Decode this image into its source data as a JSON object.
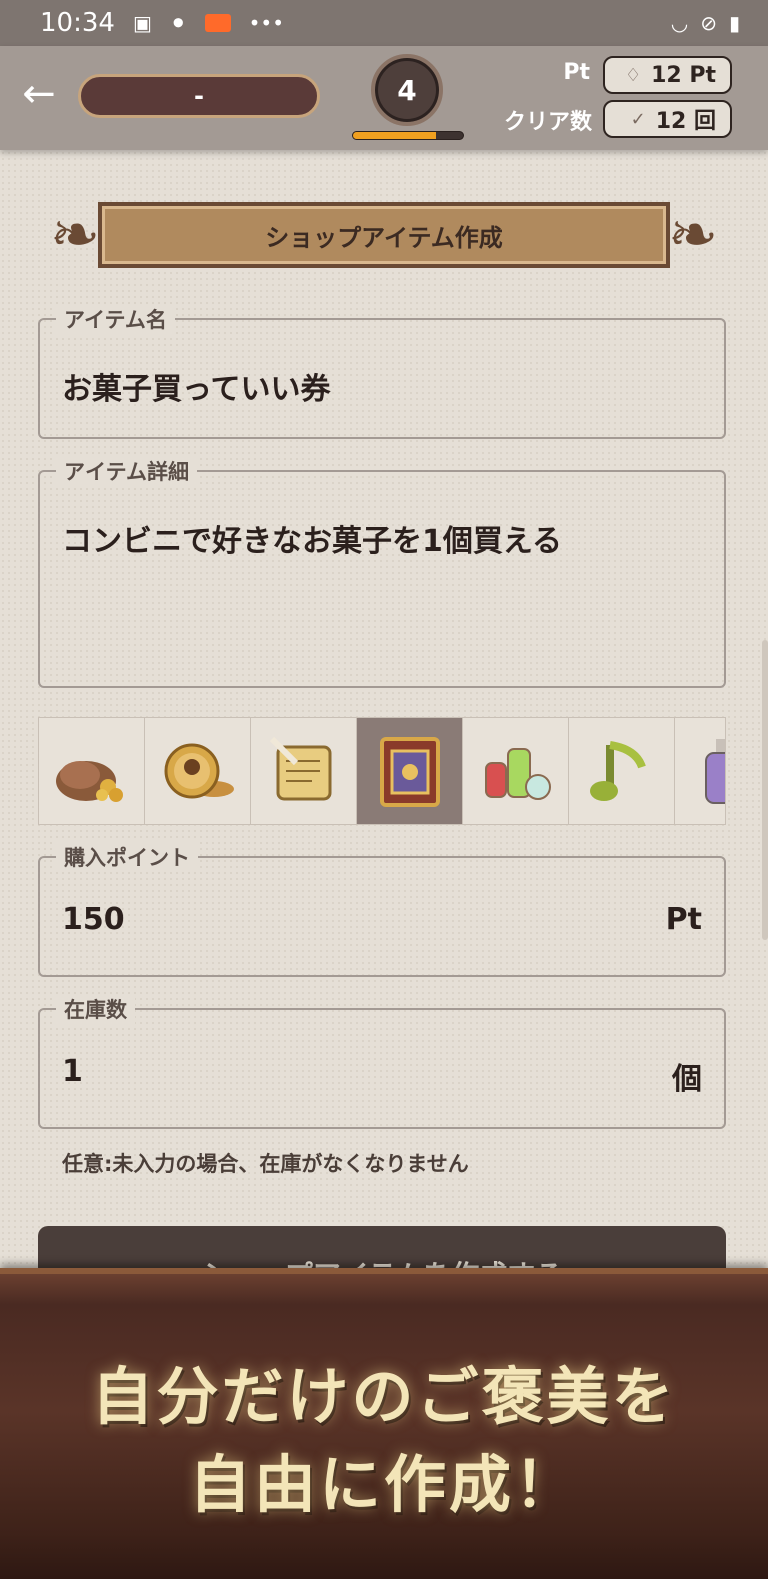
{
  "status_bar": {
    "time": "10:34",
    "icons": [
      "image-icon",
      "voicemail-icon",
      "record-icon",
      "more-icon"
    ],
    "more": "•••",
    "right_icons": [
      "wifi-icon",
      "dnd-icon",
      "battery-icon"
    ]
  },
  "header": {
    "back": "←",
    "name": "-",
    "level": "4",
    "level_progress": 0.75,
    "pt_label": "Pt",
    "pt_value": "12 Pt",
    "clear_label": "クリア数",
    "clear_value": "12 回",
    "pt_icon": "diamond-icon",
    "clear_icon": "check-icon"
  },
  "title": "ショップアイテム作成",
  "fields": {
    "item_name": {
      "label": "アイテム名",
      "value": "お菓子買っていい券"
    },
    "item_detail": {
      "label": "アイテム詳細",
      "value": "コンビニで好きなお菓子を1個買える"
    },
    "price": {
      "label": "購入ポイント",
      "value": "150",
      "unit": "Pt"
    },
    "stock": {
      "label": "在庫数",
      "value": "1",
      "unit": "個"
    }
  },
  "icons": [
    {
      "name": "coin-bag-icon",
      "selected": false
    },
    {
      "name": "coins-icon",
      "selected": false
    },
    {
      "name": "scroll-quill-icon",
      "selected": false
    },
    {
      "name": "spellbook-icon",
      "selected": true
    },
    {
      "name": "potions-icon",
      "selected": false
    },
    {
      "name": "music-note-icon",
      "selected": false
    },
    {
      "name": "bottle-icon",
      "selected": false
    }
  ],
  "note": "任意:未入力の場合、在庫がなくなりません",
  "create_button": "ショップアイテムを作成する",
  "promo": {
    "line1": "自分だけのご褒美を",
    "line2": "自由に作成！"
  },
  "colors": {
    "accent": "#f0a020",
    "header": "#a39a94",
    "selected_icon_bg": "#8a7b76"
  }
}
